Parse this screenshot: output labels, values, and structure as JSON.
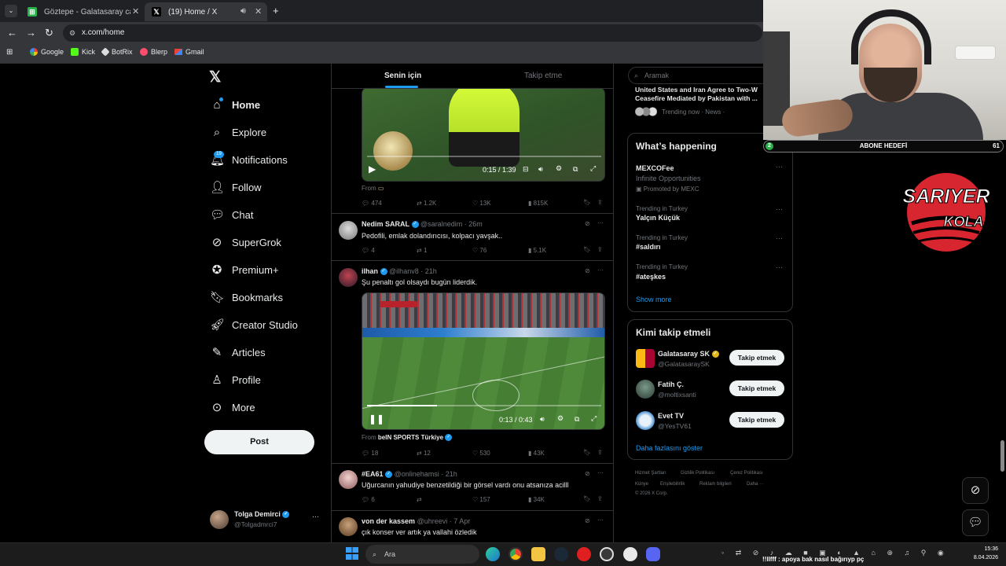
{
  "browser": {
    "tabs": [
      {
        "title": "Göztepe - Galatasaray canlı skor",
        "active": false
      },
      {
        "title": "(19) Home / X",
        "active": true
      }
    ],
    "url": "x.com/home",
    "bookmarks": [
      "Google",
      "Kick",
      "BotRix",
      "Blerp",
      "Gmail"
    ]
  },
  "nav": {
    "items": [
      {
        "label": "Home",
        "icon": "home-icon",
        "badge": ""
      },
      {
        "label": "Explore",
        "icon": "search-icon",
        "badge": ""
      },
      {
        "label": "Notifications",
        "icon": "bell-icon",
        "badge": "19"
      },
      {
        "label": "Follow",
        "icon": "follow-icon",
        "badge": ""
      },
      {
        "label": "Chat",
        "icon": "chat-icon",
        "badge": ""
      },
      {
        "label": "SuperGrok",
        "icon": "grok-icon",
        "badge": ""
      },
      {
        "label": "Premium+",
        "icon": "premium-icon",
        "badge": ""
      },
      {
        "label": "Bookmarks",
        "icon": "bookmark-icon",
        "badge": ""
      },
      {
        "label": "Creator Studio",
        "icon": "rocket-icon",
        "badge": ""
      },
      {
        "label": "Articles",
        "icon": "articles-icon",
        "badge": ""
      },
      {
        "label": "Profile",
        "icon": "person-icon",
        "badge": ""
      },
      {
        "label": "More",
        "icon": "more-circle-icon",
        "badge": ""
      }
    ],
    "post_label": "Post",
    "account": {
      "name": "Tolga Demirci",
      "handle": "@Tolgadmrci7"
    }
  },
  "feed": {
    "tabs": [
      "Senin için",
      "Takip etme"
    ],
    "tweets": [
      {
        "id": "t0",
        "video_time": "0:15 / 1:39",
        "from": "From",
        "from_source": "",
        "stats": {
          "replies": "474",
          "retweets": "1.2K",
          "likes": "13K",
          "views": "815K"
        }
      },
      {
        "id": "t1",
        "name": "Nedim SARAL",
        "handle": "@saralnedim",
        "time": "26m",
        "text": "Pedofili, emlak dolandırıcısı, kolpacı yavşak..",
        "stats": {
          "replies": "4",
          "retweets": "1",
          "likes": "76",
          "views": "5.1K"
        }
      },
      {
        "id": "t2",
        "name": "ilhan",
        "handle": "@ilhanv8",
        "time": "21h",
        "text": "Şu penaltı gol olsaydı bugün liderdik.",
        "video_time": "0:13 / 0:43",
        "video_progress": 0.3,
        "from": "From",
        "from_source": "beIN SPORTS Türkiye",
        "stats": {
          "replies": "18",
          "retweets": "12",
          "likes": "530",
          "views": "43K"
        }
      },
      {
        "id": "t3",
        "name": "#EA61",
        "handle": "@onlinehamsi",
        "time": "21h",
        "text": "Uğurcanın yahudiye benzetildiği bir görsel vardı onu atsanıza acilll",
        "stats": {
          "replies": "6",
          "retweets": "",
          "likes": "157",
          "views": "34K"
        }
      },
      {
        "id": "t4",
        "name": "von der kassem",
        "handle": "@uhreevi",
        "time": "7 Apr",
        "text": "çık konser ver artık ya vallahi özledik"
      }
    ]
  },
  "sidebar": {
    "search_placeholder": "Aramak",
    "news": {
      "headline_1": "United States and Iran Agree to Two-W",
      "headline_2": "Ceasefire Mediated by Pakistan with ...",
      "meta": "Trending now · News ·"
    },
    "whats_happening": {
      "title": "What’s happening",
      "trends": [
        {
          "meta": "",
          "name": "MEXCOFee",
          "sub": "Infinite Opportunities",
          "promo": "Promoted by MEXC"
        },
        {
          "meta": "Trending in Turkey",
          "name": "Yalçın Küçük"
        },
        {
          "meta": "Trending in Turkey",
          "name": "#saldırı"
        },
        {
          "meta": "Trending in Turkey",
          "name": "#ateşkes"
        }
      ],
      "show_more": "Show more"
    },
    "who_to_follow": {
      "title": "Kimi takip etmeli",
      "accounts": [
        {
          "name": "Galatasaray SK",
          "handle": "@GalatasaraySK",
          "button": "Takip etmek"
        },
        {
          "name": "Fatih Ç.",
          "handle": "@moltixsanti",
          "button": "Takip etmek"
        },
        {
          "name": "Evet TV",
          "handle": "@YesTV61",
          "button": "Takip etmek"
        }
      ],
      "show_more": "Daha fazlasını göster"
    },
    "footer": {
      "links": [
        "Hizmet Şartları",
        "Gizlilik Politikası",
        "Çerez Politikası",
        "Künye",
        "Erişilebilirlik",
        "Reklam bilgileri",
        "Daha ···"
      ],
      "copyright": "© 2026 X Corp."
    }
  },
  "stream": {
    "sub_goal_label": "ABONE HEDEFİ",
    "sub_goal_current": "2",
    "sub_goal_target": "61",
    "logo_line1": "SARIYER",
    "logo_line2": "KOLA",
    "chat_ticker": "!!llfff : apoya bak nasıl bağırıyp pç"
  },
  "taskbar": {
    "search_label": "Ara",
    "time": "15:36",
    "date": "8.04.2026"
  },
  "colors": {
    "accent": "#1d9bf0",
    "background": "#000000",
    "border": "#2f3336",
    "muted": "#71767b",
    "logo_red": "#d7262f"
  }
}
